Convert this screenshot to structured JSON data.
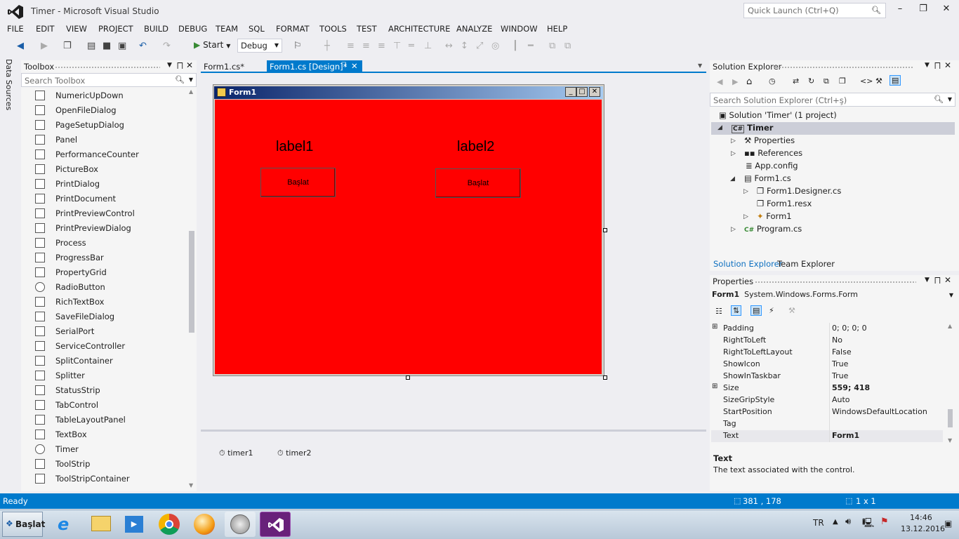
{
  "app_title": "Timer - Microsoft Visual Studio",
  "quick_launch_placeholder": "Quick Launch (Ctrl+Q)",
  "menu": [
    "FILE",
    "EDIT",
    "VIEW",
    "PROJECT",
    "BUILD",
    "DEBUG",
    "TEAM",
    "SQL",
    "FORMAT",
    "TOOLS",
    "TEST",
    "ARCHITECTURE",
    "ANALYZE",
    "WINDOW",
    "HELP"
  ],
  "toolbar": {
    "start_label": "Start",
    "config": "Debug"
  },
  "left_rail": "Data Sources",
  "toolbox": {
    "title": "Toolbox",
    "search_placeholder": "Search Toolbox",
    "items": [
      "NumericUpDown",
      "OpenFileDialog",
      "PageSetupDialog",
      "Panel",
      "PerformanceCounter",
      "PictureBox",
      "PrintDialog",
      "PrintDocument",
      "PrintPreviewControl",
      "PrintPreviewDialog",
      "Process",
      "ProgressBar",
      "PropertyGrid",
      "RadioButton",
      "RichTextBox",
      "SaveFileDialog",
      "SerialPort",
      "ServiceController",
      "SplitContainer",
      "Splitter",
      "StatusStrip",
      "TabControl",
      "TableLayoutPanel",
      "TextBox",
      "Timer",
      "ToolStrip",
      "ToolStripContainer"
    ]
  },
  "tabs": {
    "tab1": "Form1.cs*",
    "tab2": "Form1.cs [Design]*"
  },
  "form": {
    "title": "Form1",
    "label1": "label1",
    "label2": "label2",
    "button1": "Başlat",
    "button2": "Başlat",
    "back_color": "#ff0000"
  },
  "tray": {
    "timer1": "timer1",
    "timer2": "timer2"
  },
  "solution_explorer": {
    "title": "Solution Explorer",
    "search_placeholder": "Search Solution Explorer (Ctrl+ş)",
    "tree": [
      {
        "label": "Solution 'Timer' (1 project)"
      },
      {
        "label": "Timer"
      },
      {
        "label": "Properties"
      },
      {
        "label": "References"
      },
      {
        "label": "App.config"
      },
      {
        "label": "Form1.cs"
      },
      {
        "label": "Form1.Designer.cs"
      },
      {
        "label": "Form1.resx"
      },
      {
        "label": "Form1"
      },
      {
        "label": "Program.cs"
      }
    ],
    "bottom_tabs": [
      "Solution Explorer",
      "Team Explorer"
    ]
  },
  "properties": {
    "title": "Properties",
    "object_name": "Form1",
    "object_type": "System.Windows.Forms.Form",
    "rows": [
      {
        "name": "Padding",
        "value": "0; 0; 0; 0"
      },
      {
        "name": "RightToLeft",
        "value": "No"
      },
      {
        "name": "RightToLeftLayout",
        "value": "False"
      },
      {
        "name": "ShowIcon",
        "value": "True"
      },
      {
        "name": "ShowInTaskbar",
        "value": "True"
      },
      {
        "name": "Size",
        "value": "559; 418"
      },
      {
        "name": "SizeGripStyle",
        "value": "Auto"
      },
      {
        "name": "StartPosition",
        "value": "WindowsDefaultLocation"
      },
      {
        "name": "Tag",
        "value": ""
      },
      {
        "name": "Text",
        "value": "Form1"
      }
    ],
    "desc_title": "Text",
    "desc_text": "The text associated with the control."
  },
  "status": {
    "ready": "Ready",
    "position": "381 , 178",
    "size": "1 x 1"
  },
  "taskbar": {
    "start": "Başlat",
    "lang": "TR",
    "time": "14:46",
    "date": "13.12.2016"
  }
}
